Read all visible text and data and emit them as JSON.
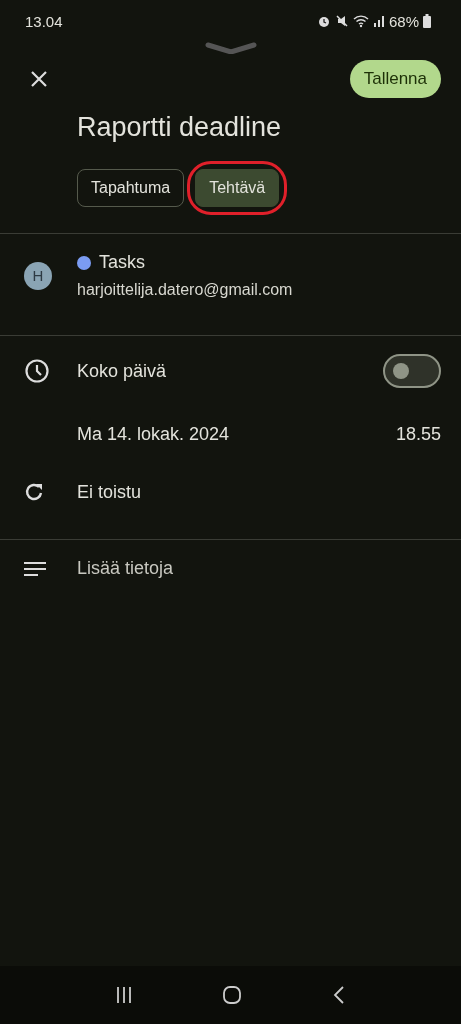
{
  "status_bar": {
    "time": "13.04",
    "battery": "68%"
  },
  "save_button": "Tallenna",
  "title": "Raportti deadline",
  "tabs": [
    {
      "label": "Tapahtuma",
      "selected": false,
      "highlighted": false
    },
    {
      "label": "Tehtävä",
      "selected": true,
      "highlighted": true
    }
  ],
  "account": {
    "avatar": "H",
    "calendar": "Tasks",
    "color": "#7b9cf2",
    "email": "harjoittelija.datero@gmail.com"
  },
  "all_day": {
    "label": "Koko päivä",
    "on": false
  },
  "date": "Ma 14. lokak. 2024",
  "time": "18.55",
  "repeat": "Ei toistu",
  "details": "Lisää tietoja"
}
